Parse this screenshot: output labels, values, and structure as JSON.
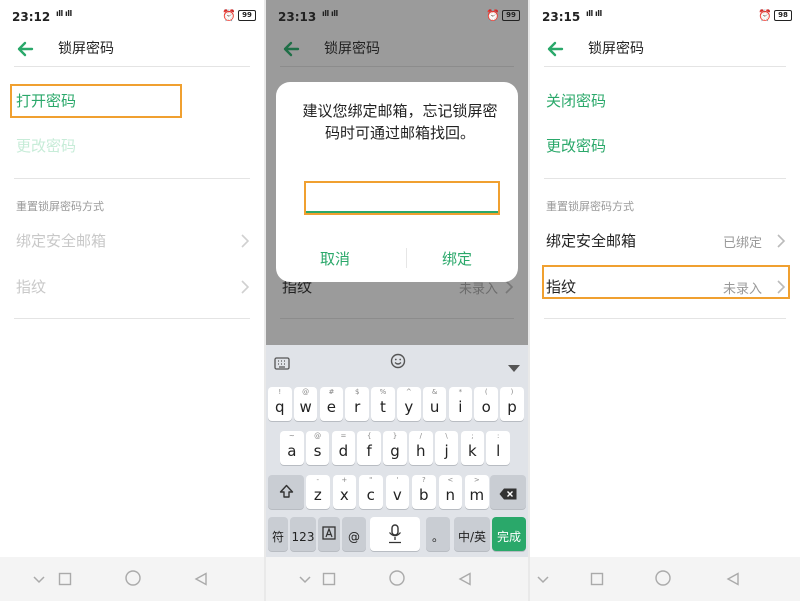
{
  "panel1": {
    "status": {
      "time": "23:12",
      "battery": "99"
    },
    "title": "锁屏密码",
    "items": [
      "打开密码",
      "更改密码"
    ],
    "section": "重置锁屏密码方式",
    "rows": [
      {
        "label": "绑定安全邮箱"
      },
      {
        "label": "指纹"
      }
    ]
  },
  "panel2": {
    "status": {
      "time": "23:13",
      "battery": "99"
    },
    "title": "锁屏密码",
    "dialog": {
      "message": "建议您绑定邮箱，忘记锁屏密码时可通过邮箱找回。",
      "email_value": "",
      "cancel": "取消",
      "confirm": "绑定"
    },
    "behind": {
      "row_label": "指纹",
      "row_value": "未录入"
    },
    "keyboard": {
      "row1": [
        [
          "!",
          "q"
        ],
        [
          "@",
          "w"
        ],
        [
          "#",
          "e"
        ],
        [
          "$",
          "r"
        ],
        [
          "%",
          "t"
        ],
        [
          "^",
          "y"
        ],
        [
          "&",
          "u"
        ],
        [
          "*",
          "i"
        ],
        [
          "(",
          "o"
        ],
        [
          ")",
          "p"
        ]
      ],
      "row2": [
        [
          "~",
          "a"
        ],
        [
          "@",
          "s"
        ],
        [
          "=",
          "d"
        ],
        [
          "{",
          "f"
        ],
        [
          "}",
          "g"
        ],
        [
          "/",
          "h"
        ],
        [
          "\\",
          "j"
        ],
        [
          ";",
          "k"
        ],
        [
          ":",
          "l"
        ]
      ],
      "row3": [
        [
          "-",
          "z"
        ],
        [
          "+",
          "x"
        ],
        [
          "\"",
          "c"
        ],
        [
          "'",
          "v"
        ],
        [
          "?",
          "b"
        ],
        [
          "<",
          "n"
        ],
        [
          ">",
          "m"
        ]
      ],
      "bottom": {
        "sym": "符",
        "num": "123",
        "at": "@",
        "dot": "。",
        "lang": "中/英",
        "done": "完成"
      }
    }
  },
  "panel3": {
    "status": {
      "time": "23:15",
      "battery": "98"
    },
    "title": "锁屏密码",
    "items": [
      "关闭密码",
      "更改密码"
    ],
    "section": "重置锁屏密码方式",
    "rows": [
      {
        "label": "绑定安全邮箱",
        "value": "已绑定"
      },
      {
        "label": "指纹",
        "value": "未录入"
      }
    ]
  },
  "colors": {
    "accent": "#2aa86a",
    "highlight": "#f0a030"
  }
}
